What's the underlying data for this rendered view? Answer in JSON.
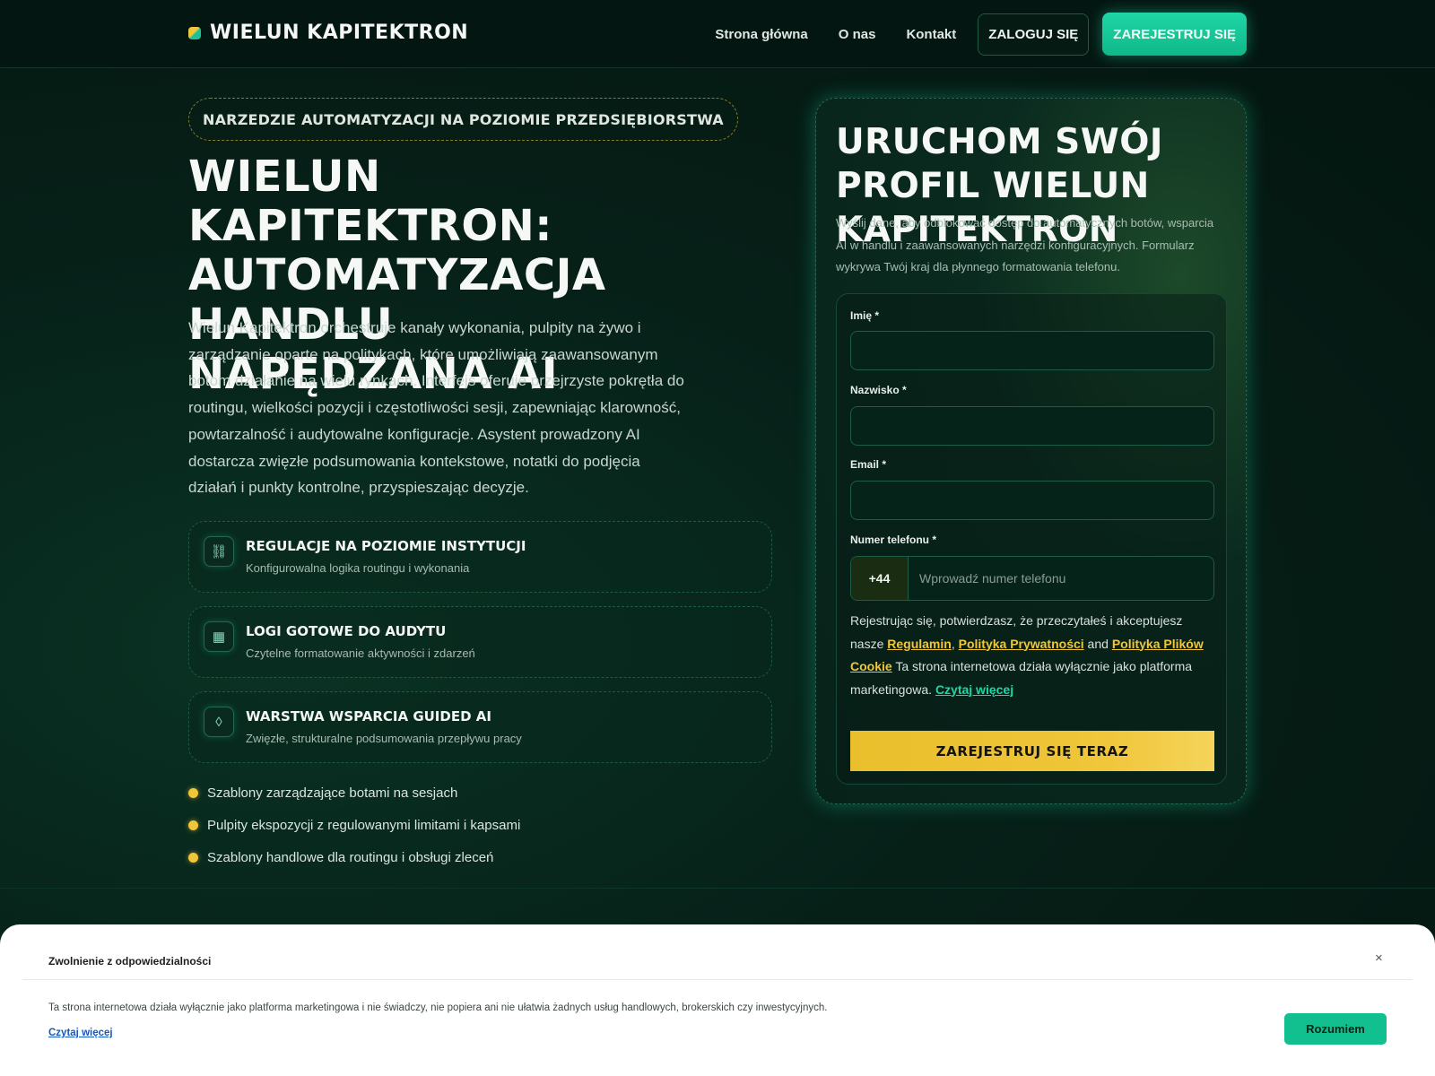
{
  "nav": {
    "brand": "WIELUN KAPITEKTRON",
    "links": [
      "Strona główna",
      "O nas",
      "Kontakt"
    ],
    "login": "ZALOGUJ SIĘ",
    "register": "ZAREJESTRUJ SIĘ"
  },
  "hero": {
    "badge": "NARZEDZIE AUTOMATYZACJI NA POZIOMIE PRZEDSIĘBIORSTWA",
    "title": "WIELUN KAPITEKTRON: AUTOMATYZACJA HANDLU NAPĘDZANA AI",
    "description": "Wielun Kapitektron orchestruje kanały wykonania, pulpity na żywo i zarządzanie oparte na politykach, które umożliwiają zaawansowanym botom działanie na wielu rynkach. Interfejs oferuje przejrzyste pokrętła do routingu, wielkości pozycji i częstotliwości sesji, zapewniając klarowność, powtarzalność i audytowalne konfiguracje. Asystent prowadzony AI dostarcza zwięzłe podsumowania kontekstowe, notatki do podjęcia działań i punkty kontrolne, przyspieszając decyzje.",
    "features": [
      {
        "icon": "⛓",
        "title": "REGULACJE NA POZIOMIE INSTYTUCJI",
        "subtitle": "Konfigurowalna logika routingu i wykonania"
      },
      {
        "icon": "▦",
        "title": "LOGI GOTOWE DO AUDYTU",
        "subtitle": "Czytelne formatowanie aktywności i zdarzeń"
      },
      {
        "icon": "◊",
        "title": "WARSTWA WSPARCIA GUIDED AI",
        "subtitle": "Zwięzłe, strukturalne podsumowania przepływu pracy"
      }
    ],
    "bullets": [
      "Szablony zarządzające botami na sesjach",
      "Pulpity ekspozycji z regulowanymi limitami i kapsami",
      "Szablony handlowe dla routingu i obsługi zleceń"
    ]
  },
  "form": {
    "title": "URUCHOM SWÓJ PROFIL WIELUN KAPITEKTRON",
    "description": "Wyślij dane, aby odblokować dostęp do automatycznych botów, wsparcia AI w handlu i zaawansowanych narzędzi konfiguracyjnych. Formularz wykrywa Twój kraj dla płynnego formatowania telefonu.",
    "first_name_label": "Imię *",
    "last_name_label": "Nazwisko *",
    "email_label": "Email *",
    "phone_label": "Numer telefonu *",
    "phone_code": "+44",
    "phone_placeholder": "Wprowadź numer telefonu",
    "consent_prefix": "Rejestrując się, potwierdzasz, że przeczytałeś i akceptujesz nasze ",
    "terms": "Regulamin",
    "sep1": ", ",
    "privacy": "Polityka Prywatności",
    "sep2": " and ",
    "cookies": "Polityka Plików Cookie",
    "consent_suffix": " Ta strona internetowa działa wyłącznie jako platforma marketingowa. ",
    "read_more": "Czytaj więcej",
    "submit": "ZAREJESTRUJ SIĘ TERAZ"
  },
  "disclaimer": {
    "title": "Zwolnienie z odpowiedzialności",
    "close": "×",
    "text": "Ta strona internetowa działa wyłącznie jako platforma marketingowa i nie świadczy, nie popiera ani nie ułatwia żadnych usług handlowych, brokerskich czy inwestycyjnych.",
    "read_more": "Czytaj więcej",
    "button": "Rozumiem"
  },
  "colors": {
    "accent_green": "#1fd6a6",
    "accent_gold": "#f0c63a",
    "background": "#04150f"
  }
}
